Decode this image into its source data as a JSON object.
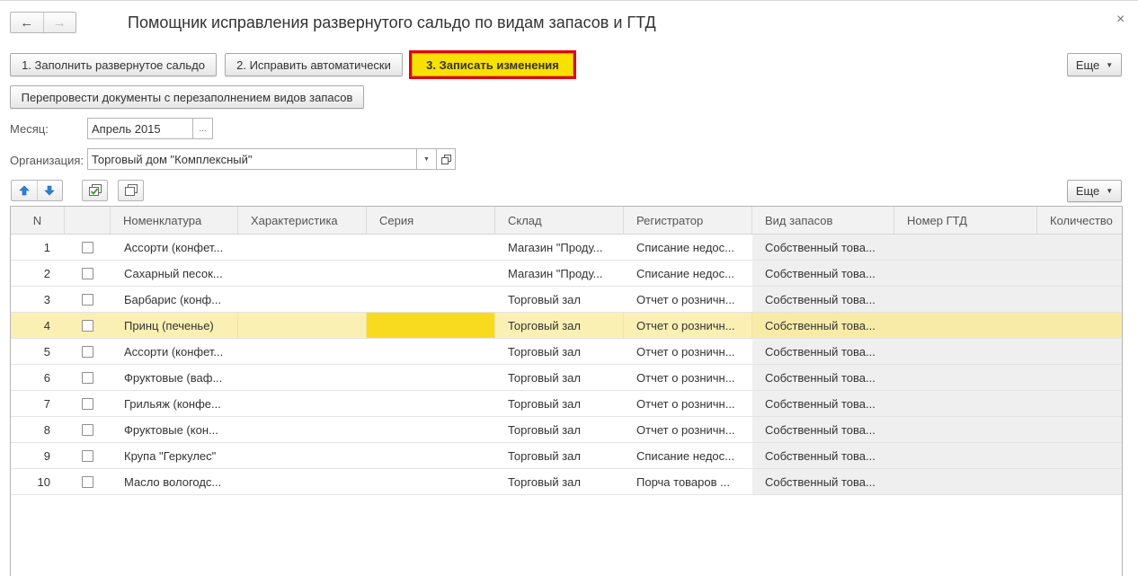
{
  "window": {
    "title": "Помощник исправления развернутого сальдо по видам запасов и ГТД",
    "back_glyph": "←",
    "forward_glyph": "→",
    "close_glyph": "×"
  },
  "toolbar": {
    "step1_label": "1. Заполнить развернутое сальдо",
    "step2_label": "2. Исправить автоматически",
    "step3_label": "3. Записать изменения",
    "more_label": "Еще",
    "repost_label": "Перепровести документы с перезаполнением видов запасов"
  },
  "form": {
    "month_label": "Месяц:",
    "month_value": "Апрель 2015",
    "month_button": "...",
    "org_label": "Организация:",
    "org_value": "Торговый дом \"Комплексный\""
  },
  "table_toolbar": {
    "more_label": "Еще"
  },
  "table": {
    "columns": [
      "N",
      "",
      "Номенклатура",
      "Характеристика",
      "Серия",
      "Склад",
      "Регистратор",
      "Вид запасов",
      "Номер ГТД",
      "Количество"
    ],
    "selected_row": 4,
    "rows": [
      {
        "n": "1",
        "nom": "Ассорти (конфет...",
        "har": "",
        "ser": "",
        "sklad": "Магазин \"Проду...",
        "reg": "Списание недос...",
        "vid": "Собственный това...",
        "gtd": "",
        "qty": ""
      },
      {
        "n": "2",
        "nom": "Сахарный песок...",
        "har": "",
        "ser": "",
        "sklad": "Магазин \"Проду...",
        "reg": "Списание недос...",
        "vid": "Собственный това...",
        "gtd": "",
        "qty": ""
      },
      {
        "n": "3",
        "nom": "Барбарис (конф...",
        "har": "",
        "ser": "",
        "sklad": "Торговый зал",
        "reg": "Отчет о розничн...",
        "vid": "Собственный това...",
        "gtd": "",
        "qty": ""
      },
      {
        "n": "4",
        "nom": "Принц (печенье)",
        "har": "",
        "ser": "",
        "sklad": "Торговый зал",
        "reg": "Отчет о розничн...",
        "vid": "Собственный това...",
        "gtd": "",
        "qty": ""
      },
      {
        "n": "5",
        "nom": "Ассорти (конфет...",
        "har": "",
        "ser": "",
        "sklad": "Торговый зал",
        "reg": "Отчет о розничн...",
        "vid": "Собственный това...",
        "gtd": "",
        "qty": ""
      },
      {
        "n": "6",
        "nom": "Фруктовые (ваф...",
        "har": "",
        "ser": "",
        "sklad": "Торговый зал",
        "reg": "Отчет о розничн...",
        "vid": "Собственный това...",
        "gtd": "",
        "qty": ""
      },
      {
        "n": "7",
        "nom": "Грильяж (конфе...",
        "har": "",
        "ser": "",
        "sklad": "Торговый зал",
        "reg": "Отчет о розничн...",
        "vid": "Собственный това...",
        "gtd": "",
        "qty": ""
      },
      {
        "n": "8",
        "nom": "Фруктовые (кон...",
        "har": "",
        "ser": "",
        "sklad": "Торговый зал",
        "reg": "Отчет о розничн...",
        "vid": "Собственный това...",
        "gtd": "",
        "qty": ""
      },
      {
        "n": "9",
        "nom": "Крупа \"Геркулес\"",
        "har": "",
        "ser": "",
        "sklad": "Торговый зал",
        "reg": "Списание недос...",
        "vid": "Собственный това...",
        "gtd": "",
        "qty": ""
      },
      {
        "n": "10",
        "nom": "Масло вологодс...",
        "har": "",
        "ser": "",
        "sklad": "Торговый зал",
        "reg": "Порча товаров ...",
        "vid": "Собственный това...",
        "gtd": "",
        "qty": ""
      }
    ]
  },
  "colors": {
    "primary_button": "#f8e000",
    "highlight_frame": "#e3000f",
    "selected_row": "#fbf0b4",
    "selected_cell": "#f8db1e"
  }
}
